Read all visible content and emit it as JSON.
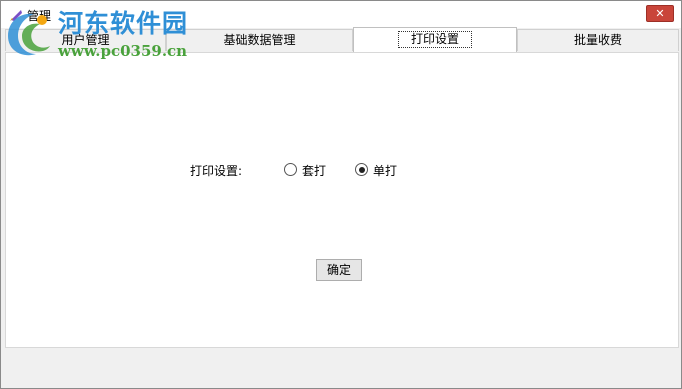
{
  "window": {
    "title": "管理",
    "close_label": "✕"
  },
  "tabs": [
    {
      "label": "用户管理"
    },
    {
      "label": "基础数据管理"
    },
    {
      "label": "打印设置"
    },
    {
      "label": "批量收费"
    }
  ],
  "active_tab": "打印设置",
  "print_settings": {
    "label": "打印设置:",
    "options": [
      {
        "label": "套打",
        "checked": false
      },
      {
        "label": "单打",
        "checked": true
      }
    ],
    "ok_label": "确定"
  },
  "watermark": {
    "title": "河东软件园",
    "url": "www.pc0359.cn"
  },
  "colors": {
    "close_button": "#c9453a",
    "watermark_title": "#2f8fd6",
    "watermark_url": "#4aa23c"
  }
}
